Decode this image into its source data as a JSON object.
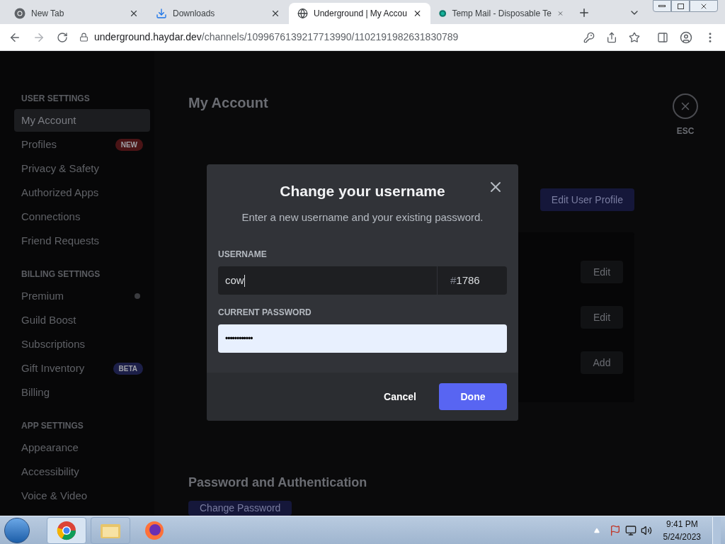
{
  "browser": {
    "tabs": [
      {
        "title": "New Tab",
        "selected": false
      },
      {
        "title": "Downloads",
        "selected": false
      },
      {
        "title": "Underground | My Accou",
        "selected": true
      },
      {
        "title": "Temp Mail - Disposable Te",
        "selected": false
      }
    ],
    "url_host": "underground.haydar.dev",
    "url_path": "/channels/1099676139217713990/1102191982631830789"
  },
  "sidebar": {
    "sections": [
      {
        "heading": "USER SETTINGS",
        "items": [
          {
            "label": "My Account",
            "selected": true
          },
          {
            "label": "Profiles",
            "selected": false,
            "badge": "NEW",
            "color": "#4a1416"
          },
          {
            "label": "Privacy & Safety",
            "selected": false
          },
          {
            "label": "Authorized Apps",
            "selected": false
          },
          {
            "label": "Connections",
            "selected": false
          },
          {
            "label": "Friend Requests",
            "selected": false
          }
        ]
      },
      {
        "heading": "BILLING SETTINGS",
        "items": [
          {
            "label": "Premium",
            "selected": false,
            "dot": true
          },
          {
            "label": "Guild Boost",
            "selected": false
          },
          {
            "label": "Subscriptions",
            "selected": false
          },
          {
            "label": "Gift Inventory",
            "selected": false,
            "badge": "BETA",
            "color": "#1c1f48"
          },
          {
            "label": "Billing",
            "selected": false
          }
        ]
      },
      {
        "heading": "APP SETTINGS",
        "items": [
          {
            "label": "Appearance",
            "selected": false
          },
          {
            "label": "Accessibility",
            "selected": false
          },
          {
            "label": "Voice & Video",
            "selected": false
          }
        ]
      }
    ]
  },
  "main": {
    "title": "My Account",
    "edit_profile_button": "Edit User Profile",
    "row_buttons": [
      "Edit",
      "Edit",
      "Add"
    ],
    "section_title": "Password and Authentication",
    "change_password_button": "Change Password",
    "esc_label": "ESC"
  },
  "modal": {
    "title": "Change your username",
    "subtitle": "Enter a new username and your existing password.",
    "username_label": "USERNAME",
    "username_value": "cow",
    "discriminator_prefix": "#",
    "discriminator": "1786",
    "password_label": "CURRENT PASSWORD",
    "password_value": "••••••••••••",
    "cancel": "Cancel",
    "done": "Done"
  },
  "taskbar": {
    "time": "9:41 PM",
    "date": "5/24/2023"
  }
}
